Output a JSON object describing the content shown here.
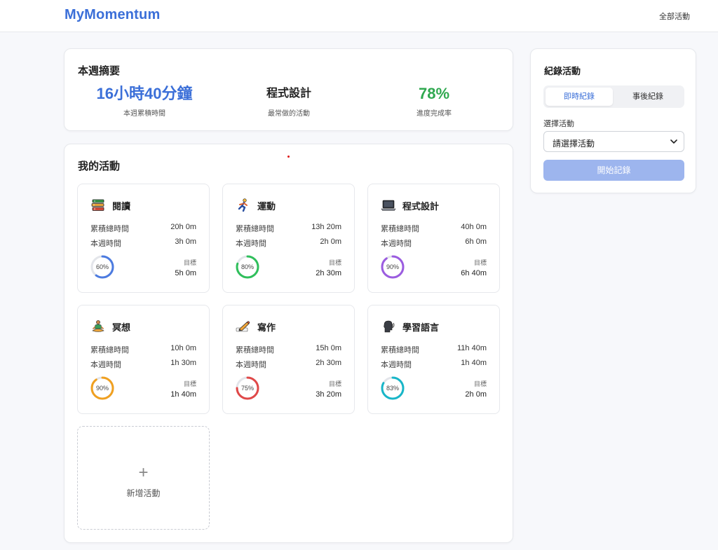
{
  "header": {
    "brand": "MyMomentum",
    "nav_all": "全部活動"
  },
  "summary": {
    "title": "本週摘要",
    "stats": [
      {
        "value": "16小時40分鐘",
        "label": "本週累積時間"
      },
      {
        "value": "程式設計",
        "label": "最常做的活動"
      },
      {
        "value": "78%",
        "label": "進度完成率"
      }
    ]
  },
  "activities": {
    "title": "我的活動",
    "total_label": "累積總時間",
    "week_label": "本週時間",
    "goal_label": "目標",
    "items": [
      {
        "name": "閱讀",
        "icon": "books-icon",
        "total": "20h 0m",
        "week": "3h 0m",
        "progress_text": "60%",
        "progress": 0.6,
        "goal": "5h 0m",
        "color": "#4c7be0"
      },
      {
        "name": "運動",
        "icon": "running-person-icon",
        "total": "13h 20m",
        "week": "2h 0m",
        "progress_text": "80%",
        "progress": 0.8,
        "goal": "2h 30m",
        "color": "#2fbf5b"
      },
      {
        "name": "程式設計",
        "icon": "laptop-icon",
        "total": "40h 0m",
        "week": "6h 0m",
        "progress_text": "90%",
        "progress": 0.9,
        "goal": "6h 40m",
        "color": "#9b5ce0"
      },
      {
        "name": "冥想",
        "icon": "meditation-icon",
        "total": "10h 0m",
        "week": "1h 30m",
        "progress_text": "90%",
        "progress": 0.9,
        "goal": "1h 40m",
        "color": "#f0a020"
      },
      {
        "name": "寫作",
        "icon": "writing-hand-icon",
        "total": "15h 0m",
        "week": "2h 30m",
        "progress_text": "75%",
        "progress": 0.75,
        "goal": "3h 20m",
        "color": "#e04848"
      },
      {
        "name": "學習語言",
        "icon": "speaking-head-icon",
        "total": "11h 40m",
        "week": "1h 40m",
        "progress_text": "83%",
        "progress": 0.83,
        "goal": "2h 0m",
        "color": "#18b6c8"
      }
    ],
    "add_plus": "+",
    "add_label": "新增活動"
  },
  "record": {
    "title": "紀錄活動",
    "tabs": [
      "即時紀錄",
      "事後紀錄"
    ],
    "select_label": "選擇活動",
    "select_value": "請選擇活動",
    "start_button": "開始記錄"
  }
}
